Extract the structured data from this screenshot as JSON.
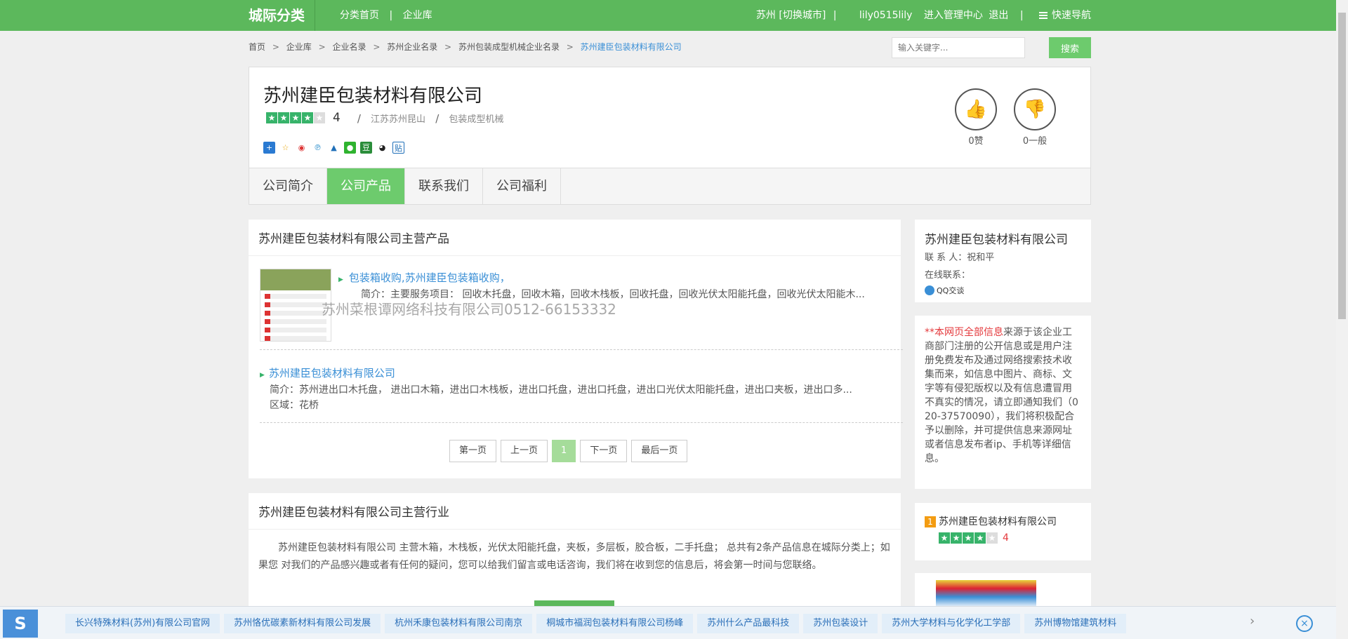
{
  "topbar": {
    "logo": "城际分类",
    "nav": [
      "分类首页",
      "|",
      "企业库"
    ],
    "city": "苏州 [切换城市]",
    "sep": "|",
    "user": "lily0515lily",
    "admin": "进入管理中心",
    "logout": "退出",
    "sep2": "|",
    "quicknav": "快速导航"
  },
  "breadcrumb": [
    "首页",
    ">",
    "企业库",
    ">",
    "企业名录",
    ">",
    "苏州企业名录",
    ">",
    "苏州包装成型机械企业名录",
    ">",
    "苏州建臣包装材料有限公司"
  ],
  "search": {
    "placeholder": "输入关键字...",
    "button": "搜索"
  },
  "company": {
    "name": "苏州建臣包装材料有限公司",
    "rating": 4,
    "score": "4",
    "location": "江苏苏州昆山",
    "slash": "/",
    "category": "包装成型机械",
    "likes": "0赞",
    "dislikes": "0一般"
  },
  "tabs": [
    "公司简介",
    "公司产品",
    "联系我们",
    "公司福利"
  ],
  "products_panel": {
    "title": "苏州建臣包装材料有限公司主营产品",
    "item1": {
      "link": "包装箱收购,苏州建臣包装箱收购，",
      "desc": "简介：主要服务项目： 回收木托盘，回收木箱，回收木栈板，回收托盘，回收光伏太阳能托盘，回收光伏太阳能木..."
    },
    "watermark": "苏州菜根谭网络科技有限公司0512-66153332",
    "item2": {
      "link": "苏州建臣包装材料有限公司",
      "desc": "简介：苏州进出口木托盘， 进出口木箱，进出口木栈板，进出口托盘，进出口托盘，进出口光伏太阳能托盘，进出口夹板，进出口多...",
      "area": "区域：花桥"
    },
    "pager": {
      "first": "第一页",
      "prev": "上一页",
      "current": "1",
      "next": "下一页",
      "last": "最后一页"
    }
  },
  "industry_panel": {
    "title": "苏州建臣包装材料有限公司主营行业",
    "text": "苏州建臣包装材料有限公司 主营木箱，木栈板，光伏太阳能托盘，夹板，多层板，胶合板，二手托盘； 总共有2条产品信息在城际分类上；如果您 对我们的产品感兴趣或者有任何的疑问，您可以给我们留言或电话咨询，我们将在收到您的信息后，将会第一时间与您联络。"
  },
  "side_contact": {
    "name": "苏州建臣包装材料有限公司",
    "contact": "联 系 人：祝和平",
    "online": "在线联系：",
    "qq": "QQ交谈"
  },
  "disclaimer": {
    "red": "**本网页全部信息",
    "text": "来源于该企业工商部门注册的公开信息或是用户注册免费发布及通过网络搜索技术收集而来，如信息中图片、商标、文字等有侵犯版权以及有信息遭冒用不真实的情况，请立即通知我们（020-37570090），我们将积极配合予以删除，并可提供信息来源网址或者信息发布者ip、手机等详细信息。"
  },
  "ranking": {
    "num": "1",
    "name": "苏州建臣包装材料有限公司",
    "rating": 4,
    "score": "4"
  },
  "bottom_tags": [
    "长兴特殊材料(苏州)有限公司官网",
    "苏州恪优碳素新材料有限公司发展",
    "杭州禾康包装材料有限公司南京",
    "桐城市福润包装材料有限公司杨峰",
    "苏州什么产品最科技",
    "苏州包装设计",
    "苏州大学材料与化学化工学部",
    "苏州博物馆建筑材料"
  ],
  "bottom_controls": {
    "logo": "S",
    "next": "›",
    "close": "×"
  },
  "colors": {
    "brand": "#5cb85c",
    "link": "#3a8fd6",
    "star": "#37b36a",
    "red": "#e4393c"
  }
}
